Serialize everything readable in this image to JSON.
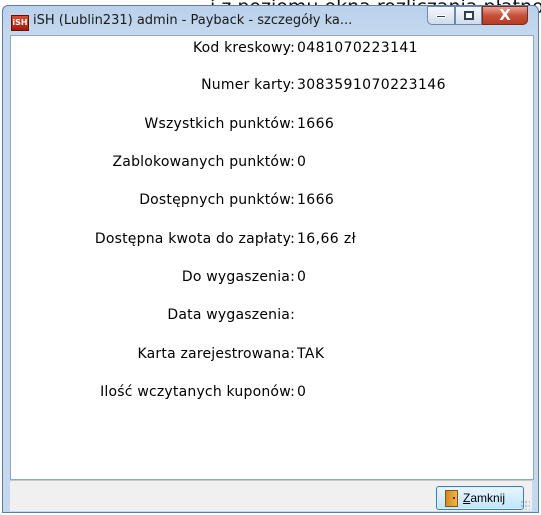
{
  "background_text": "i z poziomu okna rozliczania płatności do pun",
  "window": {
    "title": "iSH (Lublin231) admin - Payback - szczegóły ka...",
    "icon": "ish-app-icon",
    "controls": {
      "minimize_icon": "minimize-icon",
      "maximize_icon": "maximize-icon",
      "close_glyph": "X"
    }
  },
  "details": [
    {
      "label": "Kod kreskowy:",
      "value": "0481070223141"
    },
    {
      "label": "Numer karty:",
      "value": "3083591070223146"
    },
    {
      "label": "Wszystkich punktów:",
      "value": "1666"
    },
    {
      "label": "Zablokowanych punktów:",
      "value": "0"
    },
    {
      "label": "Dostępnych punktów:",
      "value": "1666"
    },
    {
      "label": "Dostępna kwota do zapłaty:",
      "value": "16,66 zł"
    },
    {
      "label": "Do wygaszenia:",
      "value": "0"
    },
    {
      "label": "Data wygaszenia:",
      "value": ""
    },
    {
      "label": "Karta zarejestrowana:",
      "value": "TAK"
    },
    {
      "label": "Ilość wczytanych kuponów:",
      "value": "0"
    }
  ],
  "footer": {
    "close_button": {
      "mnemonic": "Z",
      "label_rest": "amknij",
      "icon": "door-exit-icon"
    }
  },
  "colors": {
    "titlebar": "#c4d8ee",
    "close_button_red": "#c7503a",
    "button_border": "#3c7fb1"
  }
}
